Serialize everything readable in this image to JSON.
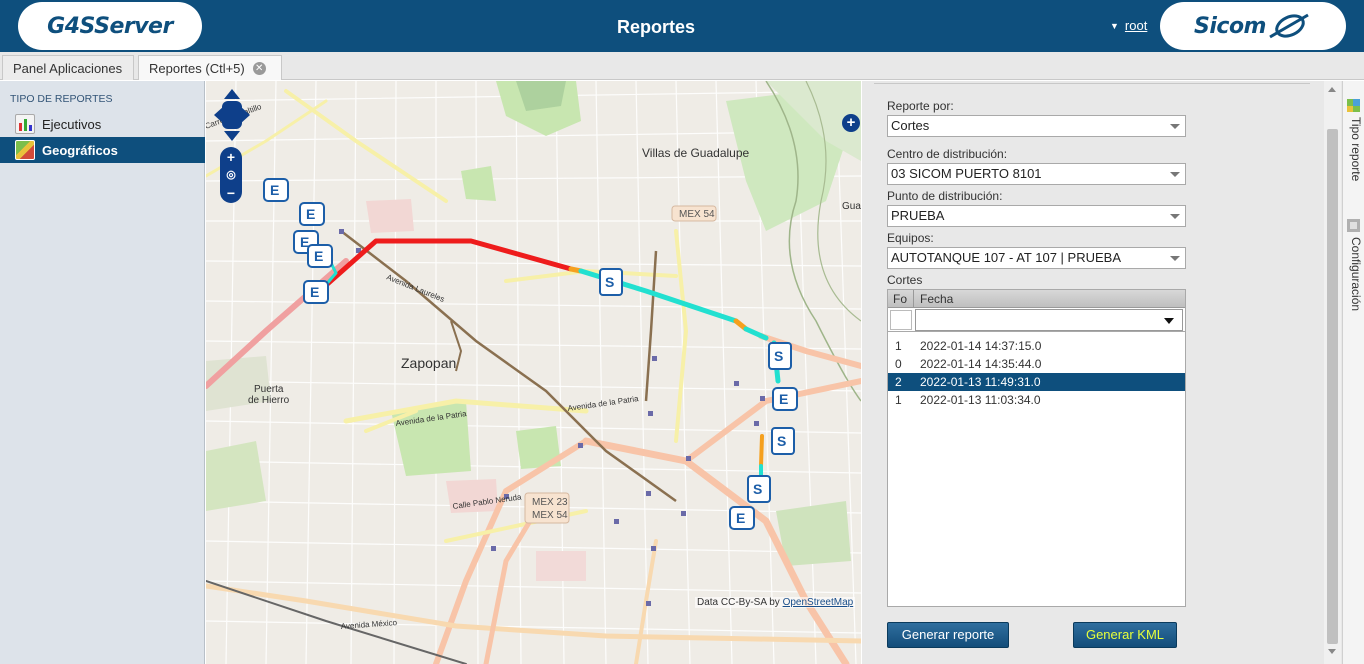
{
  "header": {
    "logo_left": "G4SServer",
    "title": "Reportes",
    "user": "root",
    "logo_right": "Sicom"
  },
  "tabs": [
    {
      "label": "Panel Aplicaciones"
    },
    {
      "label": "Reportes (Ctl+5)"
    }
  ],
  "sidebar": {
    "heading": "TIPO DE REPORTES",
    "items": [
      {
        "label": "Ejecutivos",
        "selected": false
      },
      {
        "label": "Geográficos",
        "selected": true
      }
    ]
  },
  "map": {
    "labels": {
      "villas": "Villas de Guadalupe",
      "zapopan": "Zapopan",
      "puerta_1": "Puerta",
      "puerta_2": "de Hierro",
      "mex54": "MEX 54",
      "mex23": "MEX 23",
      "mex54b": "MEX 54",
      "guad": "Gua",
      "av_laureles": "Avenida Laureles",
      "av_patria1": "Avenida de la Patria",
      "av_patria2": "Avenida de la Patria",
      "pablo_neruda": "Calle Pablo Neruda",
      "av_mexico": "Avenida México",
      "periferico": "Carretera Saltillo"
    },
    "attribution_prefix": "Data CC-By-SA by ",
    "attribution_link": "OpenStreetMap"
  },
  "form": {
    "reporte_por": {
      "label": "Reporte por:",
      "value": "Cortes"
    },
    "centro": {
      "label": "Centro de distribución:",
      "value": "03  SICOM PUERTO 8101"
    },
    "punto": {
      "label": "Punto de distribución:",
      "value": "PRUEBA"
    },
    "equipos": {
      "label": "Equipos:",
      "value": "AUTOTANQUE 107 - AT 107 | PRUEBA"
    },
    "cortes": {
      "label": "Cortes",
      "col_fo": "Fo",
      "col_fecha": "Fecha",
      "rows": [
        {
          "fo": "1",
          "fecha": "2022-01-14 14:37:15.0",
          "selected": false
        },
        {
          "fo": "0",
          "fecha": "2022-01-14 14:35:44.0",
          "selected": false
        },
        {
          "fo": "2",
          "fecha": "2022-01-13 11:49:31.0",
          "selected": true
        },
        {
          "fo": "1",
          "fecha": "2022-01-13 11:03:34.0",
          "selected": false
        }
      ]
    },
    "btn_generar": "Generar reporte",
    "btn_kml": "Generar KML"
  },
  "side_tabs": {
    "tipo": "Tipo reporte",
    "config": "Configuración"
  },
  "colors": {
    "header": "#0e4f7d",
    "selected": "#0e4f7d",
    "route_red": "#ee1c1c",
    "route_cyan": "#22e0d0",
    "route_orange": "#f5a01e"
  }
}
